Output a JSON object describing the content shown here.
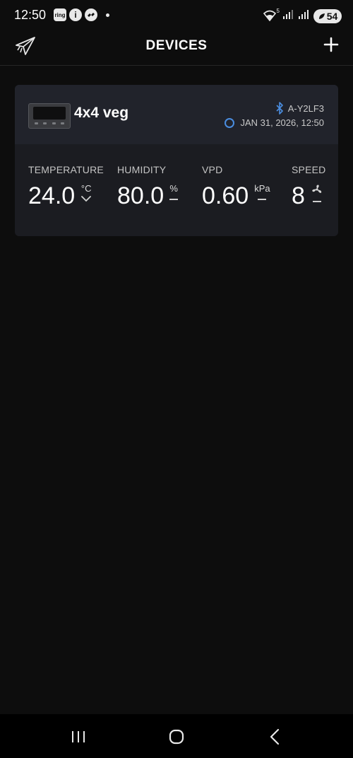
{
  "status_bar": {
    "time": "12:50",
    "left_icons": [
      {
        "icon": "ring-app-icon",
        "text": "ring"
      },
      {
        "icon": "info-icon",
        "text": "i"
      },
      {
        "icon": "messenger-icon",
        "text": ""
      }
    ],
    "right_icons": [
      "wifi-icon",
      "signal-icon",
      "signal-icon"
    ],
    "wifi_badge": "5",
    "battery": "54"
  },
  "header": {
    "title": "DEVICES",
    "logo_icon": "paper-plane-logo-icon",
    "add_icon": "plus-icon"
  },
  "device": {
    "name": "4x4 veg",
    "bluetooth_id": "A-Y2LF3",
    "timestamp": "JAN 31, 2026, 12:50",
    "metrics": [
      {
        "label": "TEMPERATURE",
        "value": "24.0",
        "unit": "°C",
        "indicator": "chevron-down-icon"
      },
      {
        "label": "HUMIDITY",
        "value": "80.0",
        "unit": "%",
        "indicator": "dash-icon"
      },
      {
        "label": "VPD",
        "value": "0.60",
        "unit": "kPa",
        "indicator": "dash-icon"
      },
      {
        "label": "SPEED",
        "value": "8",
        "unit": "",
        "indicator": "dash-icon",
        "unit_icon": "fan-icon"
      }
    ]
  },
  "colors": {
    "background": "#0d0d0d",
    "card": "#1b1c21",
    "card_header": "#21232b",
    "accent_blue": "#4a8de0"
  },
  "nav": {
    "recents_icon": "recents-icon",
    "home_icon": "home-icon",
    "back_icon": "back-icon"
  }
}
